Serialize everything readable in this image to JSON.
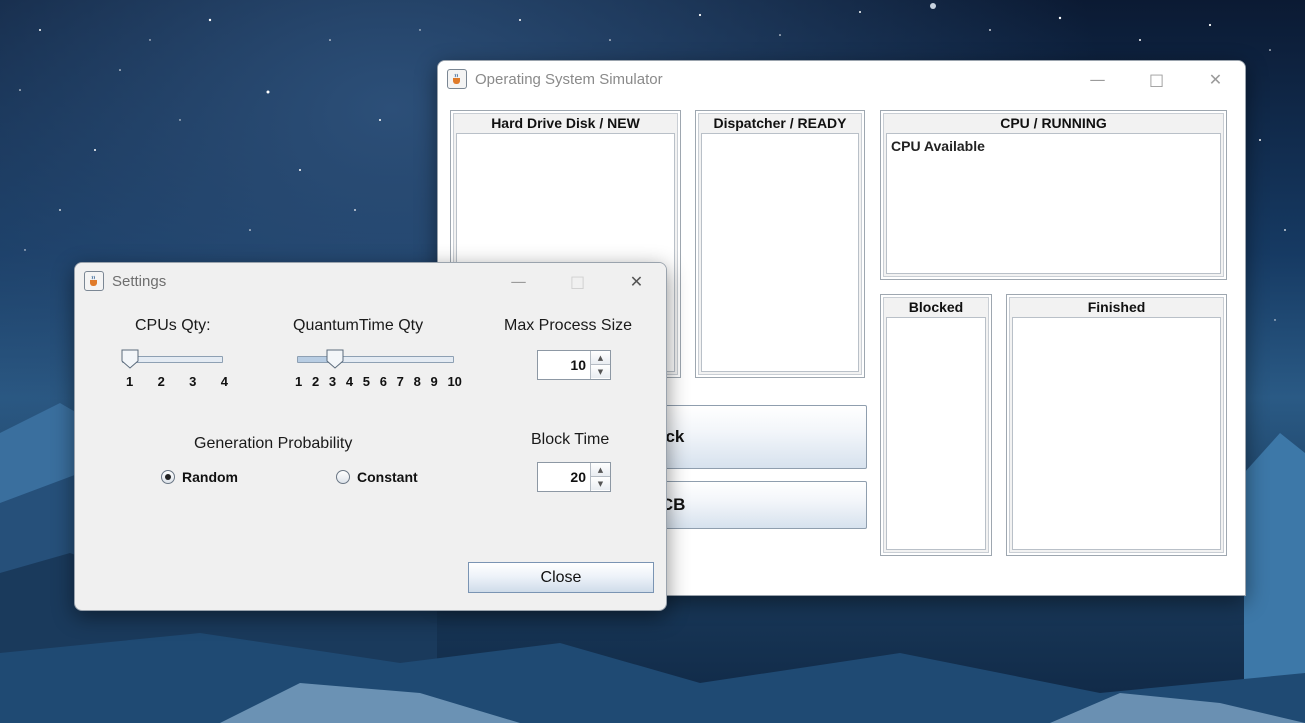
{
  "main_window": {
    "title": "Operating System Simulator",
    "panels": {
      "new": {
        "title": "Hard Drive Disk / NEW",
        "items": []
      },
      "ready": {
        "title": "Dispatcher / READY",
        "items": []
      },
      "running": {
        "title": "CPU / RUNNING",
        "items": [
          "CPU Available"
        ]
      },
      "blocked": {
        "title": "Blocked",
        "items": []
      },
      "finished": {
        "title": "Finished",
        "items": []
      }
    },
    "buttons": {
      "tick": "Tick",
      "pcb": "PCB"
    }
  },
  "settings": {
    "title": "Settings",
    "cpus": {
      "label": "CPUs Qty:",
      "ticks": [
        "1",
        "2",
        "3",
        "4"
      ],
      "value": 1
    },
    "quantum": {
      "label": "QuantumTime Qty",
      "ticks": [
        "1",
        "2",
        "3",
        "4",
        "5",
        "6",
        "7",
        "8",
        "9",
        "10"
      ],
      "value": 3
    },
    "max_process_size": {
      "label": "Max Process Size",
      "value": "10"
    },
    "generation": {
      "label": "Generation Probability",
      "options": [
        "Random",
        "Constant"
      ],
      "selected": "Random"
    },
    "block_time": {
      "label": "Block Time",
      "value": "20"
    },
    "close_label": "Close"
  },
  "icons": [
    "java-cup-icon",
    "minimize-icon",
    "maximize-icon",
    "close-icon"
  ]
}
